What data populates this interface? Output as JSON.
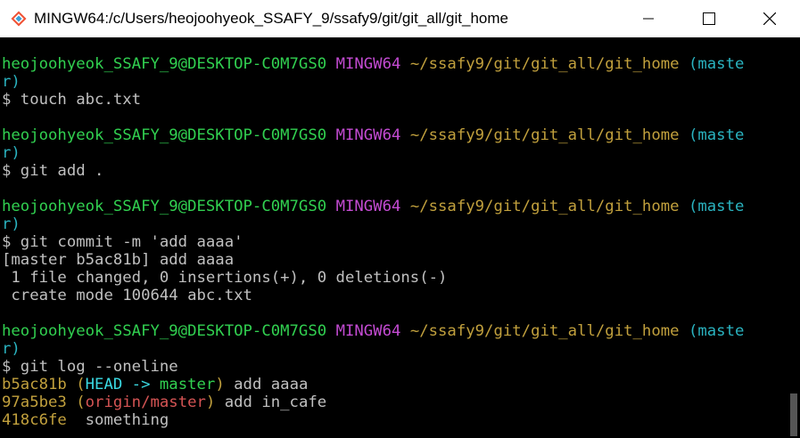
{
  "window": {
    "title": "MINGW64:/c/Users/heojoohyeok_SSAFY_9/ssafy9/git/git_all/git_home",
    "icon": "git-bash-icon",
    "controls": [
      "minimize-icon",
      "maximize-icon",
      "close-icon"
    ]
  },
  "colors": {
    "user_host": "#31d050",
    "mingw": "#c34bd2",
    "path": "#c1a03d",
    "branch": "#2ab3c0",
    "text": "#c0c0c0"
  },
  "prompt": {
    "user_host": "heojoohyeok_SSAFY_9@DESKTOP-C0M7GS0",
    "env": "MINGW64",
    "path": "~/ssafy9/git/git_all/git_home",
    "branch_open": "(maste",
    "branch_close": "r)"
  },
  "commands": [
    {
      "command": "$ touch abc.txt",
      "output": []
    },
    {
      "command": "$ git add .",
      "output": []
    },
    {
      "command": "$ git commit -m 'add aaaa'",
      "output": [
        "[master b5ac81b] add aaaa",
        " 1 file changed, 0 insertions(+), 0 deletions(-)",
        " create mode 100644 abc.txt"
      ]
    },
    {
      "command": "$ git log --oneline",
      "output": []
    }
  ],
  "log": [
    {
      "hash": "b5ac81b",
      "open": "(",
      "ref1": "HEAD -> ",
      "ref2": "master",
      "close": ")",
      "msg": " add aaaa"
    },
    {
      "hash": "97a5be3",
      "open": "(",
      "ref1": "origin/master",
      "ref2": "",
      "close": ")",
      "msg": " add in_cafe"
    },
    {
      "hash": "418c6fe",
      "open": "",
      "ref1": "",
      "ref2": "",
      "close": "",
      "msg": " something"
    }
  ]
}
